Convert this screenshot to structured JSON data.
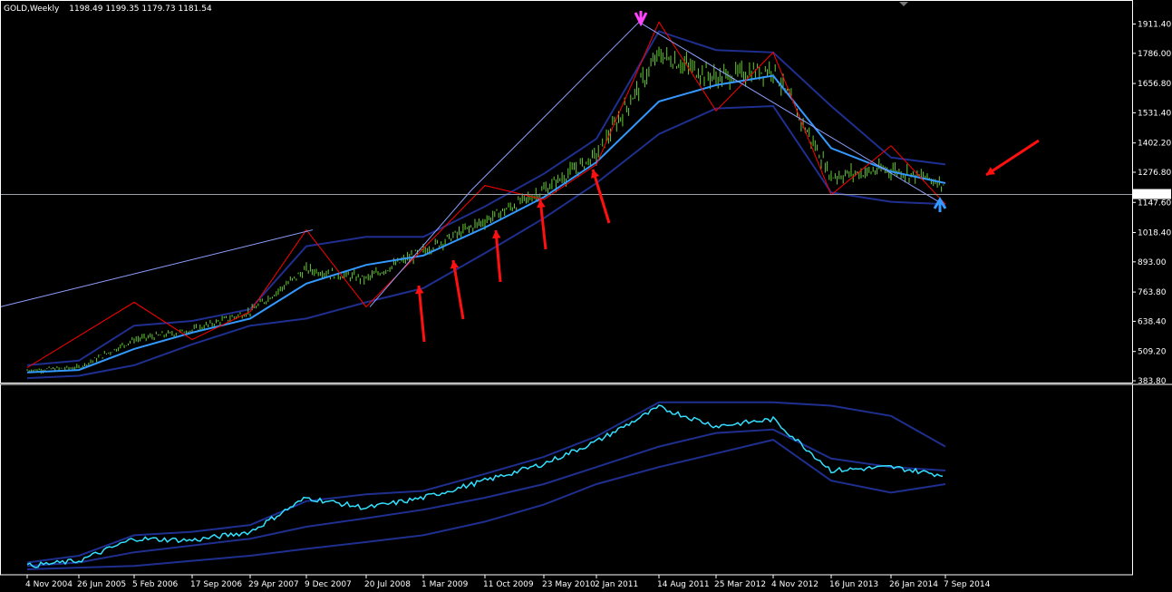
{
  "header": {
    "symbol": "GOLD,Weekly",
    "ohlc": "1198.49 1199.35 1179.73 1181.54"
  },
  "colors": {
    "background": "#000000",
    "grid_border": "#ffffff",
    "bar_up": "#66cc33",
    "moving_average": "#3399ff",
    "bollinger_bands": "#1f2f8f",
    "zigzag": "#ff0000",
    "trend_lines": "#8ea0ff",
    "annotation_arrows": "#ff1010",
    "indicator_line": "#33e0ff",
    "price_marker": "#ffffff",
    "high_marker": "#ff44ff",
    "low_marker": "#3399ff"
  },
  "price_axis": {
    "ticks": [
      "1911.40",
      "1786.00",
      "1656.80",
      "1531.40",
      "1402.20",
      "1276.80",
      "1147.60",
      "1018.40",
      "893.00",
      "763.80",
      "638.40",
      "509.20",
      "383.80"
    ],
    "current_price": "1181.54"
  },
  "time_axis": {
    "ticks": [
      "4 Nov 2004",
      "26 Jun 2005",
      "5 Feb 2006",
      "17 Sep 2006",
      "29 Apr 2007",
      "9 Dec 2007",
      "20 Jul 2008",
      "1 Mar 2009",
      "11 Oct 2009",
      "23 May 2010",
      "2 Jan 2011",
      "14 Aug 2011",
      "25 Mar 2012",
      "4 Nov 2012",
      "16 Jun 2013",
      "26 Jan 2014",
      "7 Sep 2014"
    ]
  },
  "chart_data": [
    {
      "type": "line",
      "panel": "main",
      "title": "GOLD,Weekly",
      "x": [
        "4 Nov 2004",
        "26 Jun 2005",
        "5 Feb 2006",
        "17 Sep 2006",
        "29 Apr 2007",
        "9 Dec 2007",
        "20 Jul 2008",
        "1 Mar 2009",
        "11 Oct 2009",
        "23 May 2010",
        "2 Jan 2011",
        "14 Aug 2011",
        "25 Mar 2012",
        "4 Nov 2012",
        "16 Jun 2013",
        "26 Jan 2014",
        "7 Sep 2014"
      ],
      "series": [
        {
          "values": [
            428,
            440,
            560,
            600,
            680,
            860,
            820,
            940,
            1070,
            1200,
            1350,
            1780,
            1680,
            1720,
            1260,
            1290,
            1230
          ]
        },
        {
          "values": [
            420,
            430,
            520,
            590,
            650,
            800,
            880,
            920,
            1040,
            1170,
            1320,
            1580,
            1650,
            1690,
            1380,
            1280,
            1230
          ]
        },
        {
          "values": [
            450,
            470,
            620,
            640,
            690,
            960,
            1000,
            1000,
            1130,
            1270,
            1420,
            1880,
            1800,
            1790,
            1560,
            1340,
            1310
          ]
        },
        {
          "values": [
            395,
            405,
            450,
            540,
            620,
            650,
            720,
            780,
            930,
            1080,
            1230,
            1440,
            1550,
            1560,
            1190,
            1150,
            1140
          ]
        }
      ],
      "zigzag_points": [
        {
          "x": "4 Nov 2004",
          "y": 440
        },
        {
          "x": "5 Feb 2006",
          "y": 720
        },
        {
          "x": "17 Sep 2006",
          "y": 560
        },
        {
          "x": "29 Apr 2007",
          "y": 680
        },
        {
          "x": "9 Dec 2007",
          "y": 1030
        },
        {
          "x": "20 Jul 2008",
          "y": 700
        },
        {
          "x": "11 Oct 2009",
          "y": 1220
        },
        {
          "x": "23 May 2010",
          "y": 1160
        },
        {
          "x": "2 Jan 2011",
          "y": 1310
        },
        {
          "x": "14 Aug 2011",
          "y": 1920
        },
        {
          "x": "25 Mar 2012",
          "y": 1540
        },
        {
          "x": "4 Nov 2012",
          "y": 1790
        },
        {
          "x": "16 Jun 2013",
          "y": 1180
        },
        {
          "x": "26 Jan 2014",
          "y": 1390
        },
        {
          "x": "7 Sep 2014",
          "y": 1140
        }
      ],
      "current_price": 1181.54,
      "ylim": [
        383.8,
        1960
      ]
    },
    {
      "type": "line",
      "panel": "indicator",
      "x": [
        "4 Nov 2004",
        "26 Jun 2005",
        "5 Feb 2006",
        "17 Sep 2006",
        "29 Apr 2007",
        "9 Dec 2007",
        "20 Jul 2008",
        "1 Mar 2009",
        "11 Oct 2009",
        "23 May 2010",
        "2 Jan 2011",
        "14 Aug 2011",
        "25 Mar 2012",
        "4 Nov 2012",
        "16 Jun 2013",
        "26 Jan 2014",
        "7 Sep 2014"
      ],
      "series": [
        {
          "values": [
            0.02,
            0.05,
            0.18,
            0.17,
            0.22,
            0.42,
            0.36,
            0.42,
            0.52,
            0.62,
            0.75,
            0.95,
            0.84,
            0.88,
            0.58,
            0.6,
            0.55
          ]
        },
        {
          "values": [
            0.02,
            0.04,
            0.1,
            0.14,
            0.18,
            0.25,
            0.3,
            0.35,
            0.42,
            0.5,
            0.6,
            0.72,
            0.8,
            0.82,
            0.65,
            0.6,
            0.58
          ]
        },
        {
          "values": [
            0.04,
            0.08,
            0.2,
            0.22,
            0.26,
            0.4,
            0.44,
            0.46,
            0.56,
            0.66,
            0.78,
            0.98,
            0.98,
            0.98,
            0.96,
            0.9,
            0.72
          ]
        },
        {
          "values": [
            0.0,
            0.01,
            0.02,
            0.05,
            0.08,
            0.12,
            0.16,
            0.2,
            0.28,
            0.38,
            0.5,
            0.6,
            0.68,
            0.76,
            0.52,
            0.45,
            0.5
          ]
        }
      ],
      "ylim": [
        0,
        1
      ]
    }
  ]
}
